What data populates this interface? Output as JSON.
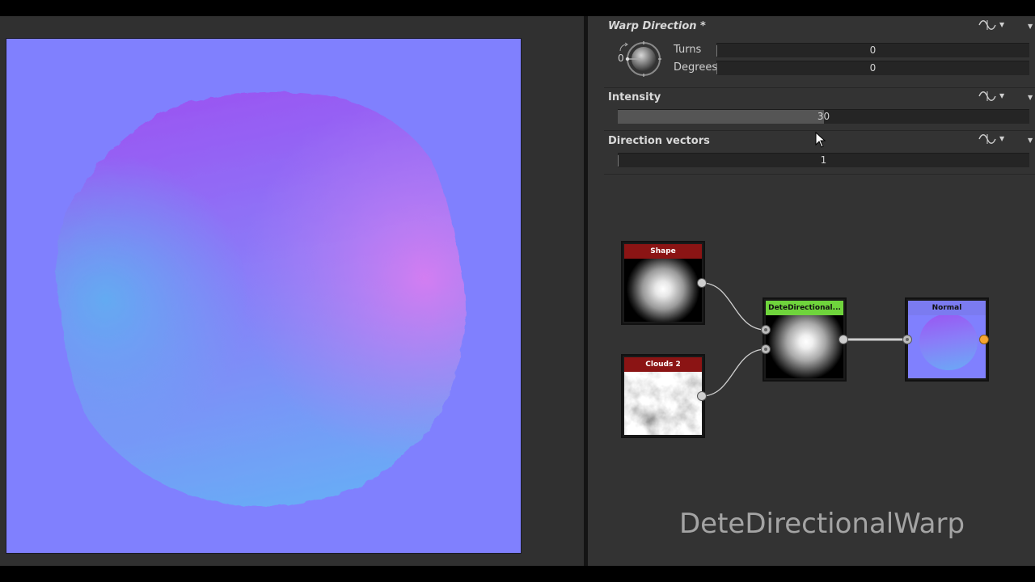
{
  "warp_direction": {
    "title": "Warp Direction *",
    "dial_value": "0",
    "turns_label": "Turns",
    "turns_value": "0",
    "degrees_label": "Degrees",
    "degrees_value": "0"
  },
  "intensity": {
    "title": "Intensity",
    "value": "30",
    "fill_fraction": 0.5
  },
  "direction_vectors": {
    "title": "Direction vectors",
    "value": "1"
  },
  "nodes": {
    "shape": {
      "title": "Shape",
      "header_color": "#8b1414"
    },
    "clouds": {
      "title": "Clouds 2",
      "header_color": "#8b1414"
    },
    "warp": {
      "title": "DeteDirectional...",
      "header_color": "#6fd43c"
    },
    "normal": {
      "title": "Normal",
      "header_color": "#7b7bf0"
    }
  },
  "watermark": "DeteDirectionalWarp",
  "colors": {
    "normal_flat": "#8080fe",
    "panel_bg": "#333333",
    "viewport_bg": "#303030",
    "output_port": "#f6a531"
  },
  "icons": [
    "wave-icon",
    "chevron-down-icon",
    "dial-icon",
    "rotate-icon",
    "mouse-cursor-icon"
  ]
}
